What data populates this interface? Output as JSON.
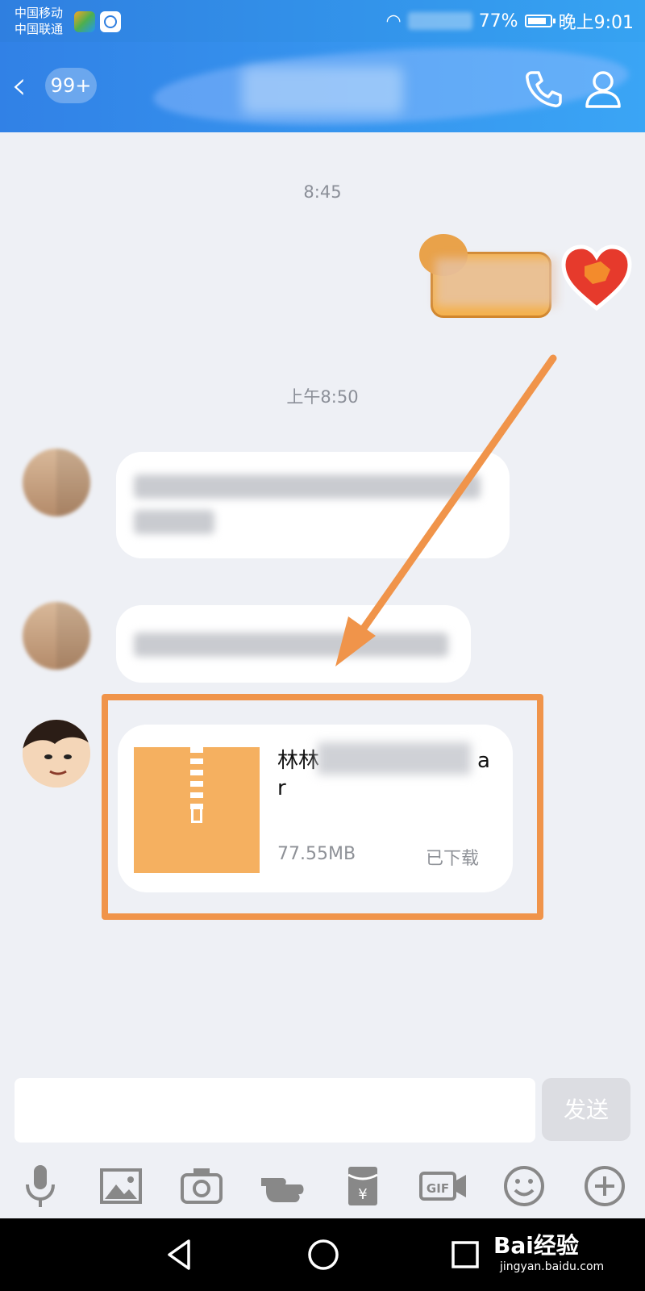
{
  "status_bar": {
    "carrier_1": "中国移动",
    "carrier_2": "中国联通",
    "battery_percent": "77%",
    "time": "晚上9:01"
  },
  "header": {
    "unread_badge": "99+",
    "back_icon": "chevron-left-icon",
    "call_icon": "phone-icon",
    "profile_icon": "profile-icon"
  },
  "messages": {
    "time_1": "8:45",
    "time_2": "上午8:50",
    "file": {
      "name": "林林",
      "name_suffix": "a\nr",
      "size": "77.55MB",
      "status": "已下载"
    }
  },
  "input": {
    "placeholder": "",
    "send_label": "发送"
  },
  "toolbar": {
    "items": [
      "microphone-icon",
      "image-icon",
      "camera-icon",
      "poke-icon",
      "red-packet-icon",
      "gif-icon",
      "emoji-icon",
      "plus-icon"
    ]
  },
  "watermark": {
    "brand": "Bai经验",
    "url": "jingyan.baidu.com"
  },
  "colors": {
    "header": "#3181e6",
    "highlight": "#f0944a",
    "zip": "#f5b060"
  }
}
